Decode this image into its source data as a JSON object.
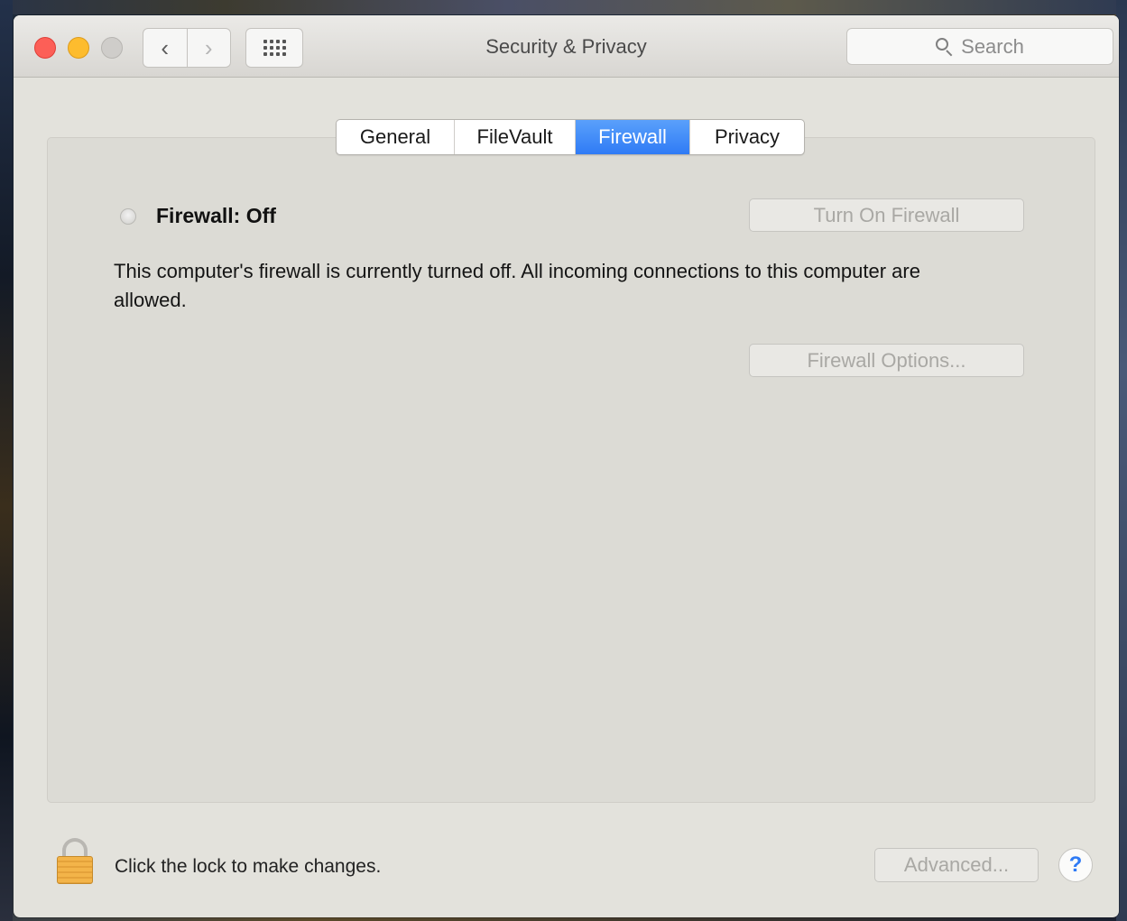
{
  "window": {
    "title": "Security & Privacy",
    "traffic_colors": {
      "close": "#fc5f57",
      "minimize": "#fdbc2e",
      "zoom": "#cfcdca"
    }
  },
  "toolbar": {
    "back_icon": "chevron-left-icon",
    "forward_icon": "chevron-right-icon",
    "show_all_icon": "grid-icon",
    "search_placeholder": "Search"
  },
  "tabs": [
    {
      "label": "General",
      "selected": false
    },
    {
      "label": "FileVault",
      "selected": false
    },
    {
      "label": "Firewall",
      "selected": true
    },
    {
      "label": "Privacy",
      "selected": false
    }
  ],
  "firewall": {
    "status_label": "Firewall: Off",
    "turn_on_label": "Turn On Firewall",
    "description": "This computer's firewall is currently turned off. All incoming connections to this computer are allowed.",
    "options_label": "Firewall Options..."
  },
  "footer": {
    "lock_label": "Click the lock to make changes.",
    "advanced_label": "Advanced...",
    "help_label": "?"
  },
  "colors": {
    "accent": "#2f7bf5",
    "window_bg": "#e3e2dc"
  }
}
